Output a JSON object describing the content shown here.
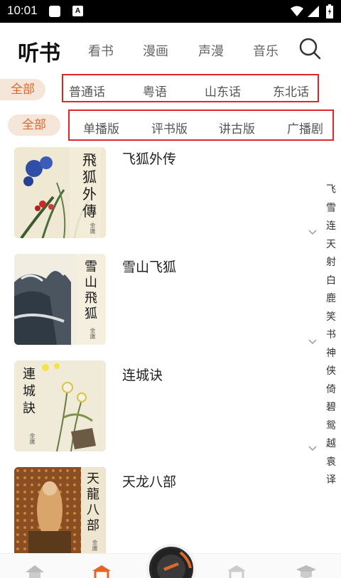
{
  "status": {
    "time": "10:01",
    "notif_label": "A"
  },
  "nav": {
    "active": "听书",
    "tabs": [
      "看书",
      "漫画",
      "声漫",
      "音乐"
    ]
  },
  "language_filter": {
    "all": "全部",
    "options": [
      "普通话",
      "粤语",
      "山东话",
      "东北话"
    ]
  },
  "edition_filter": {
    "all": "全部",
    "options": [
      "单播版",
      "评书版",
      "讲古版",
      "广播剧"
    ]
  },
  "books": [
    {
      "title": "飞狐外传",
      "cover_text": "飛狐外傳"
    },
    {
      "title": "雪山飞狐",
      "cover_text": "雪山飛狐"
    },
    {
      "title": "连城诀",
      "cover_text": "連城訣"
    },
    {
      "title": "天龙八部",
      "cover_text": "天龍八部"
    }
  ],
  "cover_signature": "金庸",
  "index": [
    "飞",
    "雪",
    "连",
    "天",
    "射",
    "白",
    "鹿",
    "笑",
    "书",
    "神",
    "侠",
    "倚",
    "碧",
    "鸳",
    "越",
    "袁",
    "译"
  ],
  "colors": {
    "accent": "#e0662a",
    "pill_bg": "#f6e6da",
    "highlight_box": "#e0262b"
  }
}
